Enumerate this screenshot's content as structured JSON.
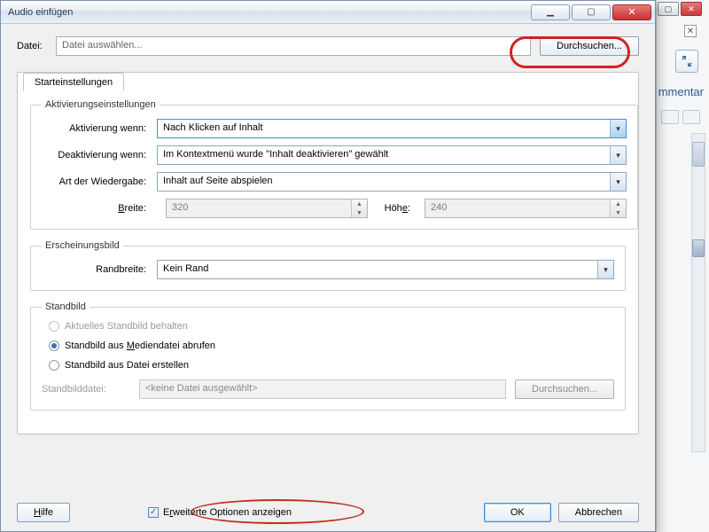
{
  "dialog": {
    "title": "Audio einfügen",
    "file_label": "Datei:",
    "file_placeholder": "Datei auswählen...",
    "browse": "Durchsuchen..."
  },
  "tab": {
    "start": "Starteinstellungen"
  },
  "activation": {
    "legend": "Aktivierungseinstellungen",
    "activate_label": "Aktivierung wenn:",
    "activate_value": "Nach Klicken auf Inhalt",
    "deactivate_label": "Deaktivierung wenn:",
    "deactivate_value": "Im Kontextmenü wurde \"Inhalt deaktivieren\" gewählt",
    "playback_label": "Art der Wiedergabe:",
    "playback_value": "Inhalt auf Seite abspielen",
    "width_label": "Breite:",
    "width_value": "320",
    "height_label": "Höhe:",
    "height_value": "240"
  },
  "appearance": {
    "legend": "Erscheinungsbild",
    "border_label": "Randbreite:",
    "border_value": "Kein Rand"
  },
  "poster": {
    "legend": "Standbild",
    "keep": "Aktuelles Standbild behalten",
    "from_media_pre": "Standbild aus ",
    "from_media_u": "M",
    "from_media_post": "ediendatei abrufen",
    "from_file": "Standbild aus Datei erstellen",
    "file_label": "Standbilddatei:",
    "file_value": "<keine Datei ausgewählt>",
    "browse": "Durchsuchen..."
  },
  "bottom": {
    "help": "Hilfe",
    "advanced_pre": "E",
    "advanced_u": "r",
    "advanced_post": "weiterte Optionen anzeigen",
    "ok": "OK",
    "cancel": "Abbrechen"
  },
  "bg": {
    "tab": "mmentar"
  }
}
